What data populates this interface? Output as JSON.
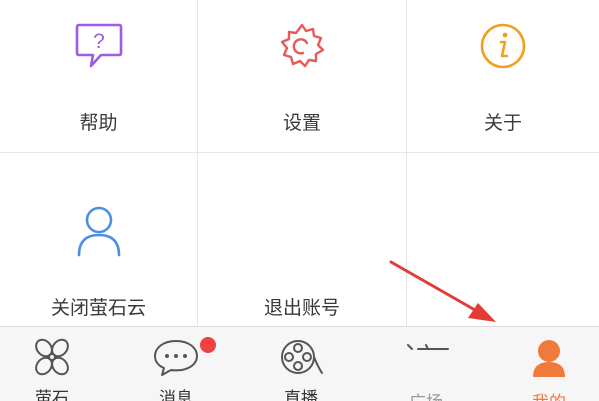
{
  "grid": {
    "items": [
      {
        "label": "帮助",
        "icon": "help-bubble-icon"
      },
      {
        "label": "设置",
        "icon": "settings-gear-icon"
      },
      {
        "label": "关于",
        "icon": "info-icon"
      },
      {
        "label": "关闭萤石云",
        "icon": "user-icon"
      },
      {
        "label": "退出账号",
        "icon": ""
      },
      {
        "label": "",
        "icon": ""
      }
    ]
  },
  "tabbar": {
    "tabs": [
      {
        "label": "萤石",
        "icon": "fan-icon"
      },
      {
        "label": "消息",
        "icon": "chat-icon",
        "badge": true
      },
      {
        "label": "直播",
        "icon": "film-reel-icon"
      },
      {
        "label": "广场",
        "icon": "square-icon"
      },
      {
        "label": "我的",
        "icon": "profile-icon",
        "active": true
      }
    ]
  },
  "colors": {
    "help": "#9b5de5",
    "settings": "#e65a5a",
    "info": "#f0a020",
    "user": "#4a90e2",
    "active": "#f07a3a",
    "badge": "#f04040",
    "arrow": "#e33b35"
  }
}
